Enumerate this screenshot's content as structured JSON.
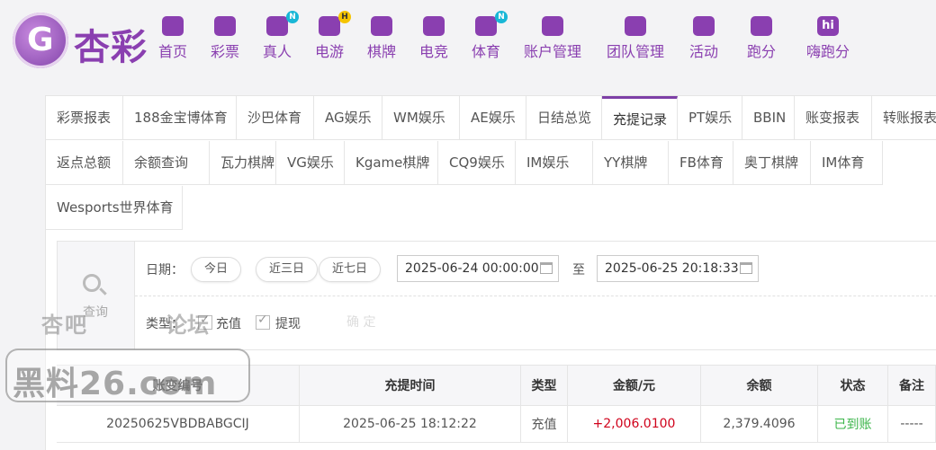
{
  "brand": {
    "name": "杏彩",
    "icon_glyph": "G"
  },
  "nav": [
    {
      "label": "首页",
      "icon": "home-icon"
    },
    {
      "label": "彩票",
      "icon": "ticket-icon"
    },
    {
      "label": "真人",
      "icon": "live-dealer-icon",
      "badge": "N"
    },
    {
      "label": "电游",
      "icon": "gamepad-icon",
      "badge": "H"
    },
    {
      "label": "棋牌",
      "icon": "cards-icon"
    },
    {
      "label": "电竞",
      "icon": "esports-controller-icon"
    },
    {
      "label": "体育",
      "icon": "trophy-icon",
      "badge": "N"
    },
    {
      "label": "账户管理",
      "icon": "account-coin-icon"
    },
    {
      "label": "团队管理",
      "icon": "team-icon"
    },
    {
      "label": "活动",
      "icon": "gift-icon"
    },
    {
      "label": "跑分",
      "icon": "running-dog-icon"
    },
    {
      "label": "嗨跑分",
      "icon": "hi-icon",
      "icon_text": "hi"
    }
  ],
  "tabs": [
    "彩票报表",
    "188金宝博体育",
    "沙巴体育",
    "AG娱乐",
    "WM娱乐",
    "AE娱乐",
    "日结总览",
    "充提记录",
    "PT娱乐",
    "BBIN",
    "账变报表",
    "转账报表",
    "返点总额",
    "余额查询",
    "瓦力棋牌",
    "VG娱乐",
    "Kgame棋牌",
    "CQ9娱乐",
    "IM娱乐",
    "YY棋牌",
    "FB体育",
    "奥丁棋牌",
    "IM体育",
    "Wesports世界体育"
  ],
  "active_tab": "充提记录",
  "filter": {
    "search_label": "查询",
    "date_label": "日期：",
    "quick_ranges": [
      "今日",
      "近三日",
      "近七日"
    ],
    "date_from": "2025-06-24 00:00:00",
    "date_to_sep": "至",
    "date_to": "2025-06-25 20:18:33",
    "type_label": "类型：",
    "types": [
      {
        "label": "充值",
        "checked": true
      },
      {
        "label": "提现",
        "checked": true
      }
    ],
    "confirm_label": "确 定"
  },
  "table": {
    "headers": [
      "账变编号",
      "充提时间",
      "类型",
      "金额/元",
      "余额",
      "状态",
      "备注"
    ],
    "rows": [
      [
        "20250625VBDBABGCIJ",
        "2025-06-25 18:12:22",
        "充值",
        "+2,006.0100",
        "2,379.4096",
        "已到账",
        "-----"
      ]
    ]
  },
  "watermark": {
    "line1_left": "杏吧",
    "line1_right": "论坛",
    "main": "黑料26.com"
  },
  "colors": {
    "brand": "#8a3fb0",
    "amount": "#d0021b",
    "status_ok": "#3bb54a"
  }
}
